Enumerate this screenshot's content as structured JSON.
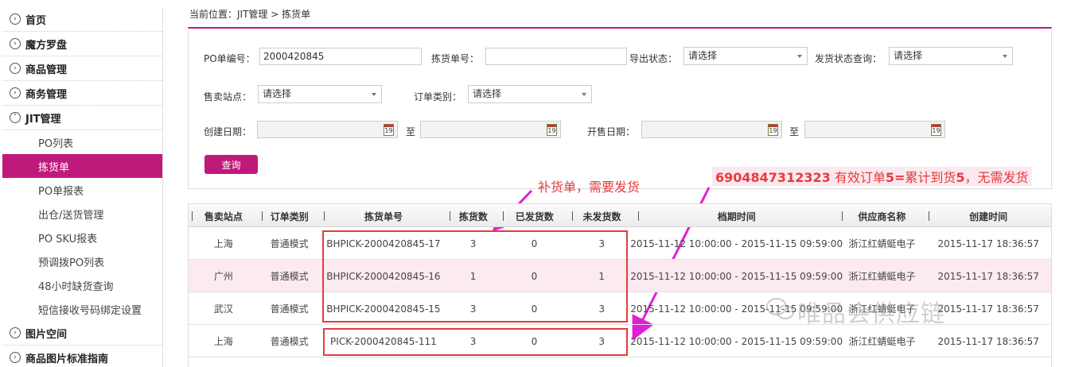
{
  "sidebar": {
    "items": [
      {
        "label": "首页",
        "type": "main"
      },
      {
        "label": "魔方罗盘",
        "type": "main"
      },
      {
        "label": "商品管理",
        "type": "main"
      },
      {
        "label": "商务管理",
        "type": "main"
      },
      {
        "label": "JIT管理",
        "type": "main",
        "expanded": true
      },
      {
        "label": "PO列表",
        "type": "sub"
      },
      {
        "label": "拣货单",
        "type": "sub",
        "active": true
      },
      {
        "label": "PO单报表",
        "type": "sub"
      },
      {
        "label": "出仓/送货管理",
        "type": "sub"
      },
      {
        "label": "PO SKU报表",
        "type": "sub"
      },
      {
        "label": "预调拨PO列表",
        "type": "sub"
      },
      {
        "label": "48小时缺货查询",
        "type": "sub"
      },
      {
        "label": "短信接收号码绑定设置",
        "type": "sub"
      },
      {
        "label": "图片空间",
        "type": "main"
      },
      {
        "label": "商品图片标准指南",
        "type": "main"
      }
    ]
  },
  "breadcrumb": "当前位置：JIT管理 > 拣货单",
  "filters": {
    "po_label": "PO单编号：",
    "po_value": "2000420845",
    "pick_label": "拣货单号：",
    "pick_value": "",
    "export_label": "导出状态：",
    "export_value": "请选择",
    "ship_label": "发货状态查询：",
    "ship_value": "请选择",
    "site_label": "售卖站点：",
    "site_value": "请选择",
    "order_type_label": "订单类别：",
    "order_type_value": "请选择",
    "created_label": "创建日期：",
    "to_label": "至",
    "sale_label": "开售日期：",
    "to_label_2": "至",
    "calendar_day": "19",
    "query_button": "查询"
  },
  "annotations": {
    "note_1": "补货单，需要发货",
    "note_2_code": "6904847312323",
    "note_2_a": " 有效订单",
    "note_2_b": "5=",
    "note_2_c": "累计到货",
    "note_2_d": "5",
    "note_2_e": "，无需发货"
  },
  "table": {
    "headers": [
      "售卖站点",
      "订单类别",
      "拣货单号",
      "拣货数",
      "已发货数",
      "未发货数",
      "档期时间",
      "供应商名称",
      "创建时间"
    ],
    "rows": [
      [
        "上海",
        "普通模式",
        "BHPICK-2000420845-17",
        "3",
        "0",
        "3",
        "2015-11-12 10:00:00 - 2015-11-15 09:59:00",
        "浙江红蜻蜓电子",
        "2015-11-17 18:36:57"
      ],
      [
        "广州",
        "普通模式",
        "BHPICK-2000420845-16",
        "1",
        "0",
        "1",
        "2015-11-12 10:00:00 - 2015-11-15 09:59:00",
        "浙江红蜻蜓电子",
        "2015-11-17 18:36:57"
      ],
      [
        "武汉",
        "普通模式",
        "BHPICK-2000420845-15",
        "3",
        "0",
        "3",
        "2015-11-12 10:00:00 - 2015-11-15 09:59:00",
        "浙江红蜻蜓电子",
        "2015-11-17 18:36:57"
      ],
      [
        "上海",
        "普通模式",
        "PICK-2000420845-111",
        "3",
        "0",
        "3",
        "2015-11-12 10:00:00 - 2015-11-15 09:59:00",
        "浙江红蜻蜓电子",
        "2015-11-17 18:36:57"
      ]
    ]
  },
  "watermark": "唯品会供应链",
  "colors": {
    "brand": "#c0197c",
    "annotation": "#e53b3b"
  },
  "icons": {
    "nav": "chevron-circle-icon",
    "date": "calendar-icon",
    "select": "caret-down-icon",
    "watermark": "wechat-icon"
  }
}
